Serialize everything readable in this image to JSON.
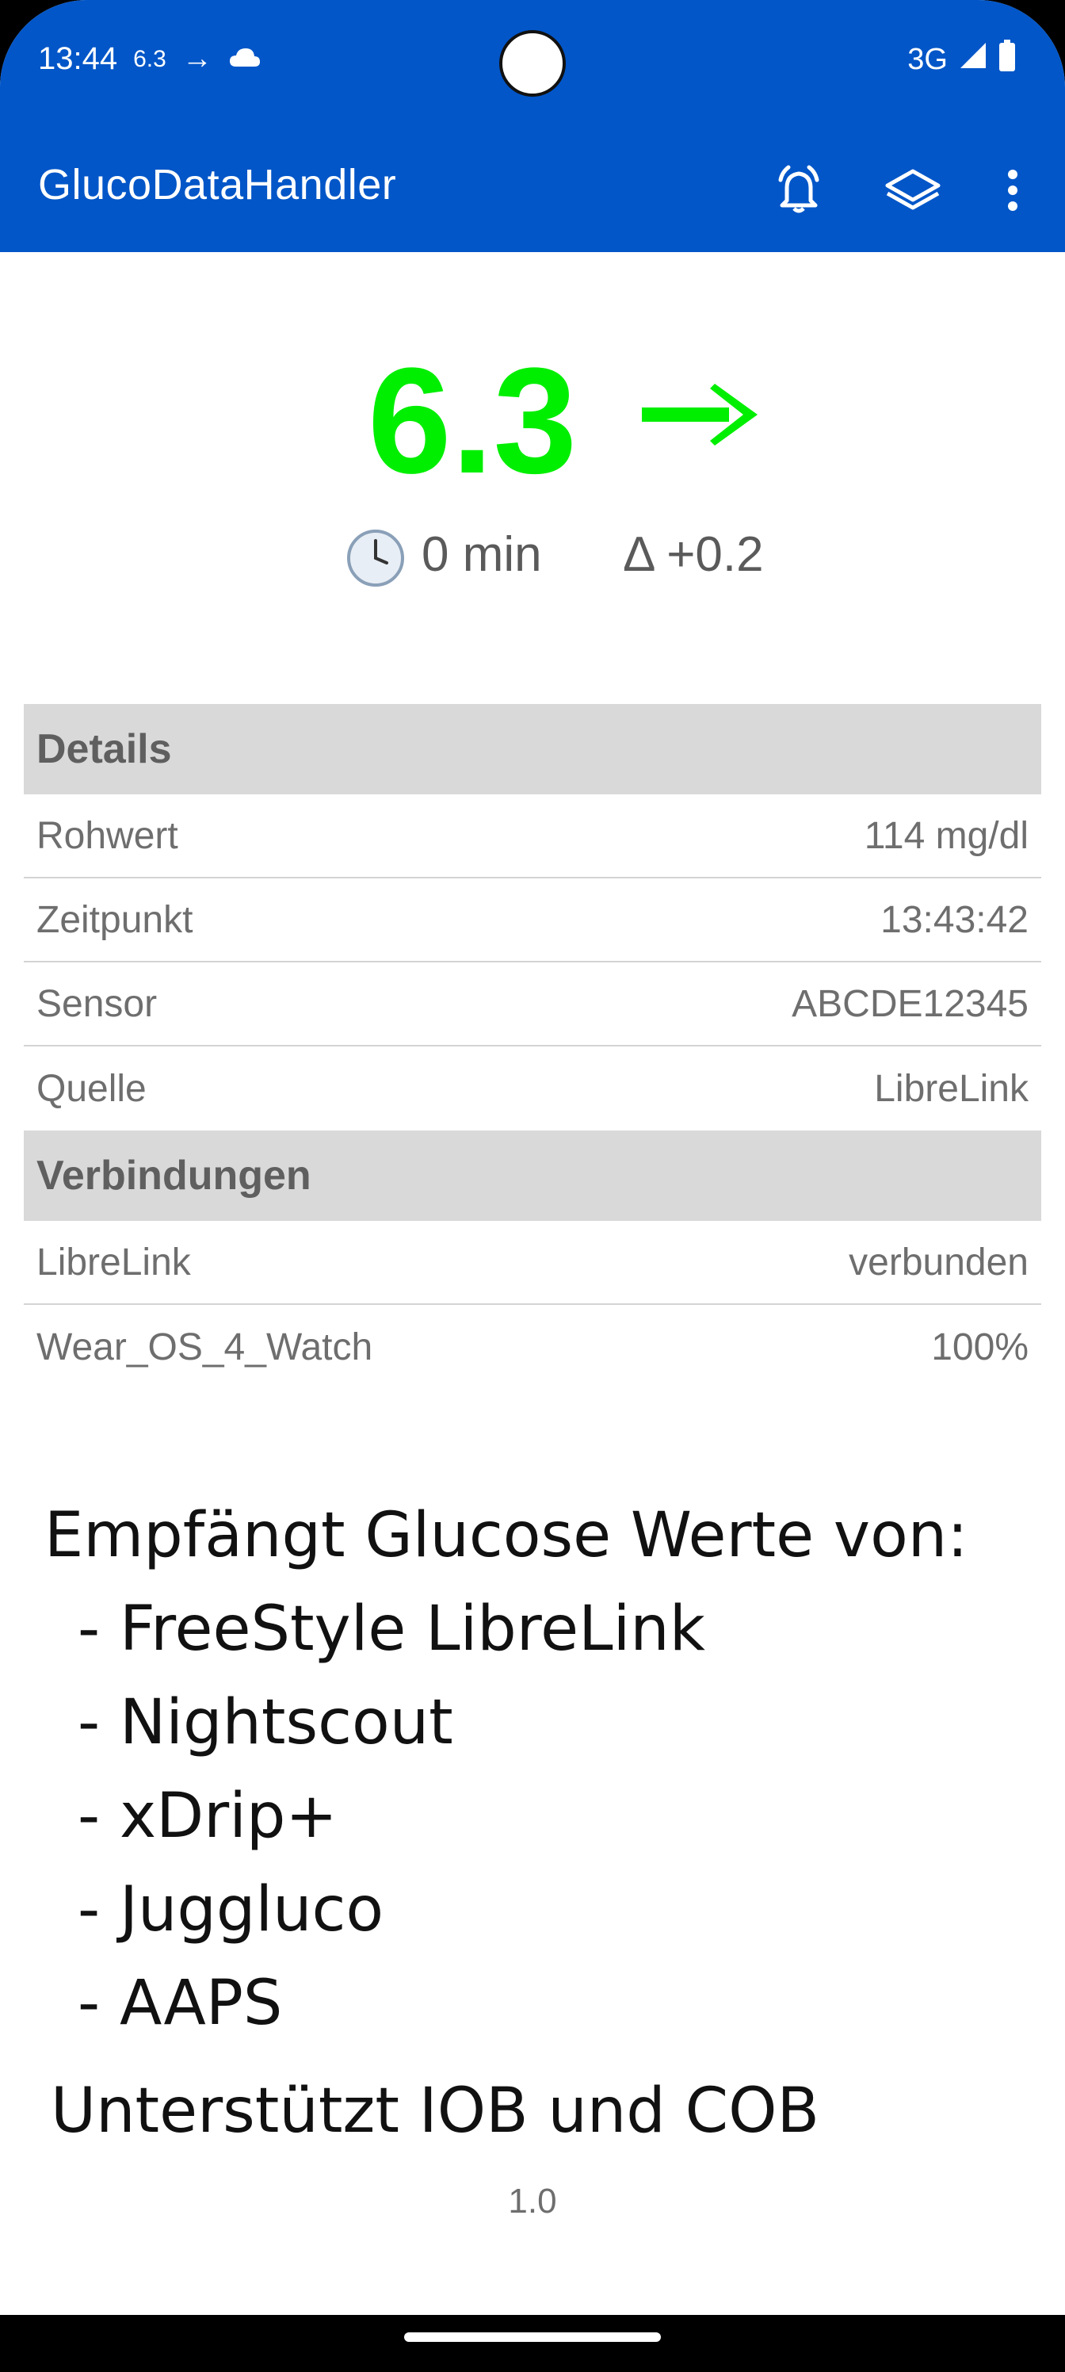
{
  "status_bar": {
    "time": "13:44",
    "glucose_small": "6.3",
    "arrow": "→",
    "network": "3G"
  },
  "app_bar": {
    "title": "GlucoDataHandler",
    "icons": [
      "alarm-icon",
      "layers-icon",
      "more-vert-icon"
    ]
  },
  "glucose": {
    "value": "6.3",
    "trend": "→",
    "color": "#00ee00",
    "minutes": "0 min",
    "delta": "Δ +0.2"
  },
  "details": {
    "header": "Details",
    "rows": [
      {
        "label": "Rohwert",
        "value": "114 mg/dl"
      },
      {
        "label": "Zeitpunkt",
        "value": "13:43:42"
      },
      {
        "label": "Sensor",
        "value": "ABCDE12345"
      },
      {
        "label": "Quelle",
        "value": "LibreLink"
      }
    ]
  },
  "connections": {
    "header": "Verbindungen",
    "rows": [
      {
        "label": "LibreLink",
        "value": "verbunden"
      },
      {
        "label": "Wear_OS_4_Watch",
        "value": "100%"
      }
    ]
  },
  "promo": {
    "title": "Empfängt Glucose Werte von:",
    "items": [
      "- FreeStyle LibreLink",
      "- Nightscout",
      "- xDrip+",
      "- Juggluco",
      "- AAPS"
    ],
    "footer": "Unterstützt IOB und COB"
  },
  "version": "1.0",
  "colors": {
    "app_bar": "#0256c8",
    "section_header": "#d9d9d9"
  }
}
